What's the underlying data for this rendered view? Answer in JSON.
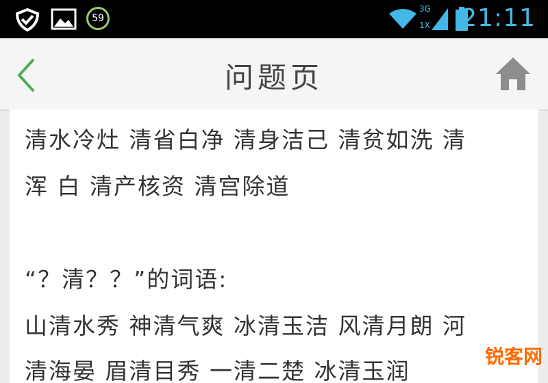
{
  "status_bar": {
    "time": "21:11",
    "notification_badge": "59",
    "network_labels": [
      "3G",
      "1X"
    ],
    "icons": [
      "shield-check-icon",
      "image-icon",
      "badge-59-icon",
      "wifi-icon",
      "signal-icon",
      "battery-icon"
    ]
  },
  "nav": {
    "title": "问题页",
    "back_icon": "chevron-left-icon",
    "home_icon": "home-icon",
    "accent_color": "#4caf50"
  },
  "content": {
    "lines": [
      "清水冷灶 清省白净 清身洁己 清贫如洗 清",
      "浑 白 清产核资 清宫除道",
      "",
      "“？清？？”的词语:",
      "山清水秀 神清气爽 冰清玉洁 风清月朗 河",
      "清海晏 眉清目秀 一清二楚 冰清玉润"
    ]
  },
  "watermark": "锐客网"
}
